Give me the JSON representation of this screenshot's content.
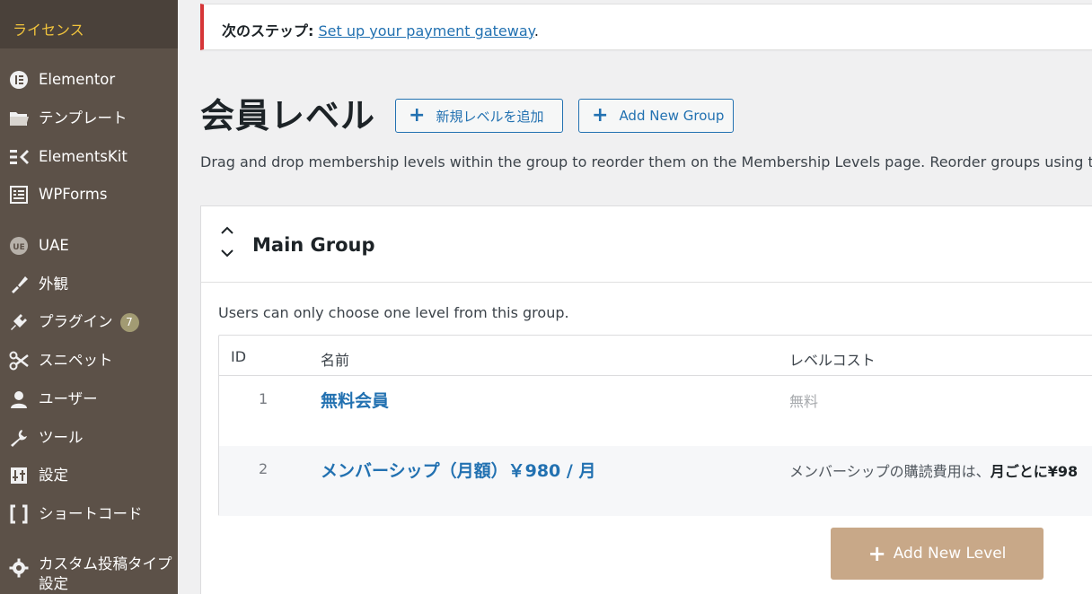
{
  "sidebar": {
    "active_submenu": "ライセンス",
    "items": [
      {
        "label": "Elementor",
        "icon": "elementor-icon"
      },
      {
        "label": "テンプレート",
        "icon": "folder-icon"
      },
      {
        "label": "ElementsKit",
        "icon": "elementskit-icon"
      },
      {
        "label": "WPForms",
        "icon": "wpforms-icon"
      },
      {
        "label": "UAE",
        "icon": "uae-icon"
      },
      {
        "label": "外観",
        "icon": "paintbrush-icon"
      },
      {
        "label": "プラグイン",
        "icon": "plugin-icon",
        "badge": "7"
      },
      {
        "label": "スニペット",
        "icon": "scissors-icon"
      },
      {
        "label": "ユーザー",
        "icon": "user-icon"
      },
      {
        "label": "ツール",
        "icon": "wrench-icon"
      },
      {
        "label": "設定",
        "icon": "settings-icon"
      },
      {
        "label": "ショートコード",
        "icon": "shortcode-icon"
      },
      {
        "label": "カスタム投稿タイプ設定",
        "icon": "gear-icon"
      }
    ]
  },
  "notice": {
    "prefix": "次のステップ:",
    "link": "Set up your payment gateway",
    "suffix": "."
  },
  "page": {
    "title": "会員レベル",
    "add_level_button": "新規レベルを追加",
    "add_group_button": "Add New Group",
    "description": "Drag and drop membership levels within the group to reorder them on the Membership Levels page. Reorder groups using the u"
  },
  "group": {
    "name": "Main Group",
    "note": "Users can only choose one level from this group.",
    "table": {
      "headers": {
        "id": "ID",
        "name": "名前",
        "cost": "レベルコスト"
      },
      "rows": [
        {
          "id": "1",
          "name": "無料会員",
          "cost": "無料"
        },
        {
          "id": "2",
          "name": "メンバーシップ（月額）￥980 / 月",
          "cost": "メンバーシップの購読費用は、",
          "cost_bold": "月ごとに¥98"
        }
      ]
    },
    "add_level_button": "Add New Level"
  },
  "colors": {
    "sidebar_bg": "#5c5148",
    "active_submenu_text": "#f0c33c",
    "link": "#2271b1",
    "notice_border": "#d63638",
    "add_level_bg": "#c8a888"
  }
}
